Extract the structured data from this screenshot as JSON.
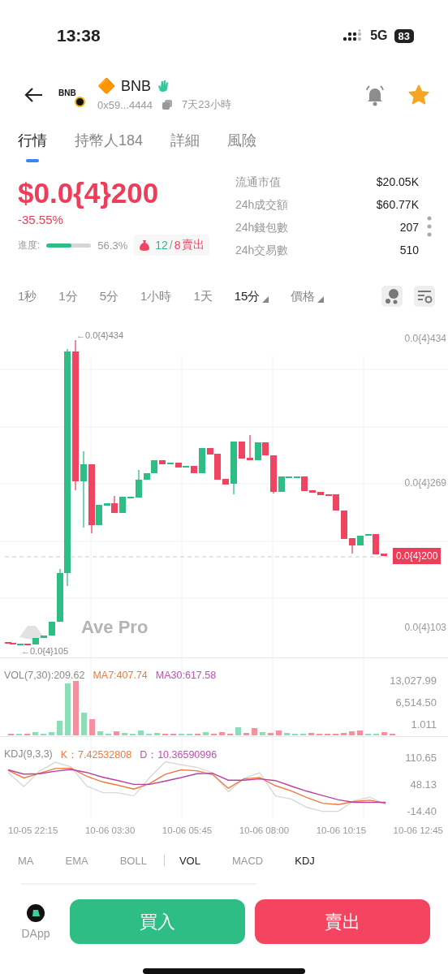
{
  "status_bar": {
    "time": "13:38",
    "network": "5G",
    "battery": "83"
  },
  "header": {
    "token_logo_text": "BNB",
    "symbol_icon": "🔶",
    "symbol": "BNB",
    "address": "0x59...4444",
    "age": "7天23小時",
    "favorite": true
  },
  "tabs": [
    {
      "label": "行情",
      "selected": true
    },
    {
      "label": "持幣人184",
      "selected": false
    },
    {
      "label": "詳細",
      "selected": false
    },
    {
      "label": "風險",
      "selected": false
    }
  ],
  "price": {
    "value": "$0.0{4}200",
    "change": "-35.55%",
    "progress_label": "進度:",
    "level": 0.563,
    "progress_text": "56.3%",
    "trade_counts": [
      {
        "text": "12",
        "kind": "buy"
      },
      {
        "text": "/",
        "kind": "plain"
      },
      {
        "text": "8",
        "kind": "sell"
      },
      {
        "text": "賣出",
        "kind": "sell"
      }
    ]
  },
  "stats": [
    {
      "label": "流通市值",
      "value": "$20.05K"
    },
    {
      "label": "24h成交額",
      "value": "$60.77K"
    },
    {
      "label": "24h錢包數",
      "value": "207"
    },
    {
      "label": "24h交易數",
      "value": "510"
    }
  ],
  "intervals": [
    {
      "label": "1秒",
      "selected": false,
      "dropdown": false
    },
    {
      "label": "1分",
      "selected": false,
      "dropdown": false
    },
    {
      "label": "5分",
      "selected": false,
      "dropdown": false
    },
    {
      "label": "1小時",
      "selected": false,
      "dropdown": false
    },
    {
      "label": "1天",
      "selected": false,
      "dropdown": false
    },
    {
      "label": "15分",
      "selected": true,
      "dropdown": true
    },
    {
      "label": "價格",
      "selected": false,
      "dropdown": true
    }
  ],
  "chart": {
    "watermark": "Ave Pro",
    "high_marker": "←0.0{4}434",
    "low_marker": "←0.0{4}105",
    "current_price": "0.0{4}200",
    "y_labels": [
      "0.0{4}434",
      "0.0{4}269",
      "0.0{4}103"
    ],
    "volume_legend": [
      {
        "text": "VOL(7,30):209.62",
        "color": "#8a8a8a"
      },
      {
        "text": "MA7:407.74",
        "color": "#f07a3c"
      },
      {
        "text": "MA30:617.58",
        "color": "#c34fb4"
      }
    ],
    "volume_labels": [
      "13,027.99",
      "6,514.50",
      "1.011"
    ],
    "kdj_legend": [
      {
        "text": "KDJ(9,3,3)",
        "color": "#8a8a8a"
      },
      {
        "text": "K：7.42532808",
        "color": "#f07a3c"
      },
      {
        "text": "D：10.36590996",
        "color": "#c34fb4"
      }
    ],
    "kdj_chart": {
      "chart_data": {
        "type": "line",
        "ylim": [
          -28,
          162
        ],
        "yticks": [
          {
            "value": 110.65,
            "label": "110.65"
          },
          {
            "value": 48.13,
            "label": "48.13"
          },
          {
            "value": -14.4,
            "label": "-14.40"
          }
        ],
        "series": [
          {
            "color": "#d8d8d8",
            "values": [
              79,
              46,
              82,
              103,
              92,
              47,
              32,
              31,
              24,
              67,
              104,
              97,
              91,
              78,
              34,
              65,
              78,
              24,
              17,
              -3,
              -12,
              -12,
              13,
              21,
              4
            ]
          },
          {
            "color": "#f07a3c",
            "values": [
              84,
              66,
              77,
              88,
              89,
              70,
              57,
              49,
              40,
              53,
              75,
              85,
              83,
              74,
              42,
              64,
              67,
              48,
              36,
              20,
              7,
              4,
              11,
              14,
              7
            ]
          },
          {
            "color": "#b8429f",
            "values": [
              85,
              75,
              76,
              82,
              86,
              79,
              68,
              60,
              51,
              51,
              59,
              67,
              76,
              77,
              61,
              61,
              64,
              60,
              47,
              35,
              25,
              15,
              9,
              9,
              9
            ]
          }
        ]
      }
    },
    "x_labels": [
      "10-05 22:15",
      "10-06 03:30",
      "10-06 05:45",
      "10-06 08:00",
      "10-06 10:15",
      "10-06 12:45"
    ]
  },
  "indicators": [
    {
      "label": "MA",
      "selected": false
    },
    {
      "label": "EMA",
      "selected": false
    },
    {
      "label": "BOLL",
      "selected": false
    },
    {
      "label": "VOL",
      "selected": true
    },
    {
      "label": "MACD",
      "selected": false
    },
    {
      "label": "KDJ",
      "selected": true
    }
  ],
  "bottom": {
    "dapp_label": "DApp",
    "buy": "買入",
    "sell": "賣出"
  }
}
